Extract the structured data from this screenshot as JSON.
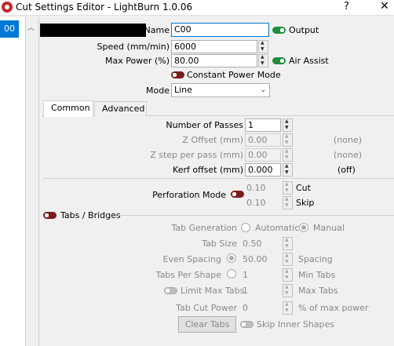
{
  "window": {
    "title": "Cut Settings Editor - LightBurn 1.0.06",
    "help_label": "?",
    "close_label": "✕"
  },
  "layer_list": {
    "selected_item": "00"
  },
  "header": {
    "name_label": "Name",
    "name_value": "C00",
    "output_label": "Output",
    "speed_label": "Speed (mm/min)",
    "speed_value": "6000",
    "maxpower_label": "Max Power (%)",
    "maxpower_value": "80.00",
    "air_assist_label": "Air Assist",
    "constant_power_label": "Constant Power Mode",
    "mode_label": "Mode",
    "mode_value": "Line"
  },
  "tabs": [
    {
      "label": "Common"
    },
    {
      "label": "Advanced"
    }
  ],
  "common": {
    "passes_label": "Number of Passes",
    "passes_value": "1",
    "zoffset_label": "Z Offset (mm)",
    "zoffset_value": "0.00",
    "zoffset_note": "(none)",
    "zstep_label": "Z step per pass (mm)",
    "zstep_value": "0.00",
    "zstep_note": "(none)",
    "kerf_label": "Kerf offset (mm)",
    "kerf_value": "0.000",
    "kerf_note": "(off)",
    "perf_label": "Perforation Mode",
    "perf_cut_value": "0.10",
    "perf_cut_label": "Cut",
    "perf_skip_value": "0.10",
    "perf_skip_label": "Skip",
    "tabs_label": "Tabs / Bridges",
    "tabgen_label": "Tab Generation",
    "auto_label": "Automatic",
    "manual_label": "Manual",
    "tabsize_label": "Tab Size",
    "tabsize_value": "0.50",
    "even_label": "Even Spacing",
    "even_value": "50.00",
    "spacing_label": "Spacing",
    "tabsper_label": "Tabs Per Shape",
    "tabsper_value": "1",
    "mintabs_label": "Min Tabs",
    "limit_label": "Limit Max Tabs",
    "limit_value": "1",
    "maxtabs_label": "Max Tabs",
    "tabcut_label": "Tab Cut Power",
    "tabcut_value": "0",
    "tabcut_unit": "% of max power",
    "clear_tabs_label": "Clear Tabs",
    "skip_inner_label": "Skip Inner Shapes"
  },
  "colors": {
    "accent": "#0078d7",
    "toggle_on": "#1f8f3a",
    "toggle_off": "#7a1c1c"
  }
}
